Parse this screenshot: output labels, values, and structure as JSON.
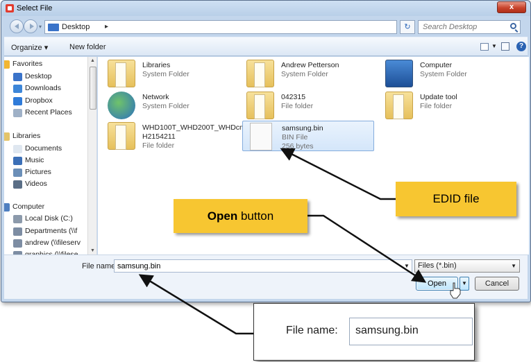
{
  "window": {
    "title": "Select File",
    "close_label": "x"
  },
  "address": {
    "path": "Desktop",
    "separator": "▸",
    "search_placeholder": "Search Desktop"
  },
  "toolbar": {
    "organize": "Organize ▾",
    "new_folder": "New folder"
  },
  "nav": {
    "items": [
      {
        "label": "Favorites",
        "icon": "star-icon",
        "head": true
      },
      {
        "label": "Desktop",
        "icon": "desktop-icon"
      },
      {
        "label": "Downloads",
        "icon": "downloads-icon"
      },
      {
        "label": "Dropbox",
        "icon": "dropbox-icon"
      },
      {
        "label": "Recent Places",
        "icon": "recent-places-icon"
      },
      {
        "label": "Libraries",
        "icon": "libraries-icon",
        "head": true
      },
      {
        "label": "Documents",
        "icon": "documents-icon"
      },
      {
        "label": "Music",
        "icon": "music-icon"
      },
      {
        "label": "Pictures",
        "icon": "pictures-icon"
      },
      {
        "label": "Videos",
        "icon": "videos-icon"
      },
      {
        "label": "Computer",
        "icon": "computer-icon",
        "head": true
      },
      {
        "label": "Local Disk (C:)",
        "icon": "disk-icon"
      },
      {
        "label": "Departments (\\\\f",
        "icon": "network-drive-icon"
      },
      {
        "label": "andrew (\\\\fileserv",
        "icon": "network-drive-icon"
      },
      {
        "label": "graphics (\\\\filese",
        "icon": "network-drive-icon"
      }
    ]
  },
  "files": [
    {
      "name": "Libraries",
      "type": "System Folder",
      "icon": "libraries-folder-icon"
    },
    {
      "name": "Andrew Petterson",
      "type": "System Folder",
      "icon": "user-folder-icon"
    },
    {
      "name": "Computer",
      "type": "System Folder",
      "icon": "computer-icon"
    },
    {
      "name": "Network",
      "type": "System Folder",
      "icon": "network-icon"
    },
    {
      "name": "042315",
      "type": "File folder",
      "icon": "folder-icon"
    },
    {
      "name": "Update tool",
      "type": "File folder",
      "icon": "folder-icon"
    },
    {
      "name": "WHD100T_WHD200T_WHDcmnRU",
      "name2": "H2154211",
      "type": "File folder",
      "icon": "folder-icon"
    },
    {
      "name": "samsung.bin",
      "type": "BIN File",
      "size": "256 bytes",
      "icon": "bin-file-icon",
      "selected": true
    }
  ],
  "bottom": {
    "file_name_label": "File name:",
    "file_name_value": "samsung.bin",
    "filter": "Files (*.bin)",
    "open": "Open",
    "cancel": "Cancel"
  },
  "callouts": {
    "edid": "EDID file",
    "open_bold": "Open",
    "open_rest": " button",
    "zoom_label": "File name:",
    "zoom_value": "samsung.bin"
  },
  "colors": {
    "callout": "#f7c631",
    "selection": "#d4e6fa",
    "frame": "#c3d6ec"
  }
}
